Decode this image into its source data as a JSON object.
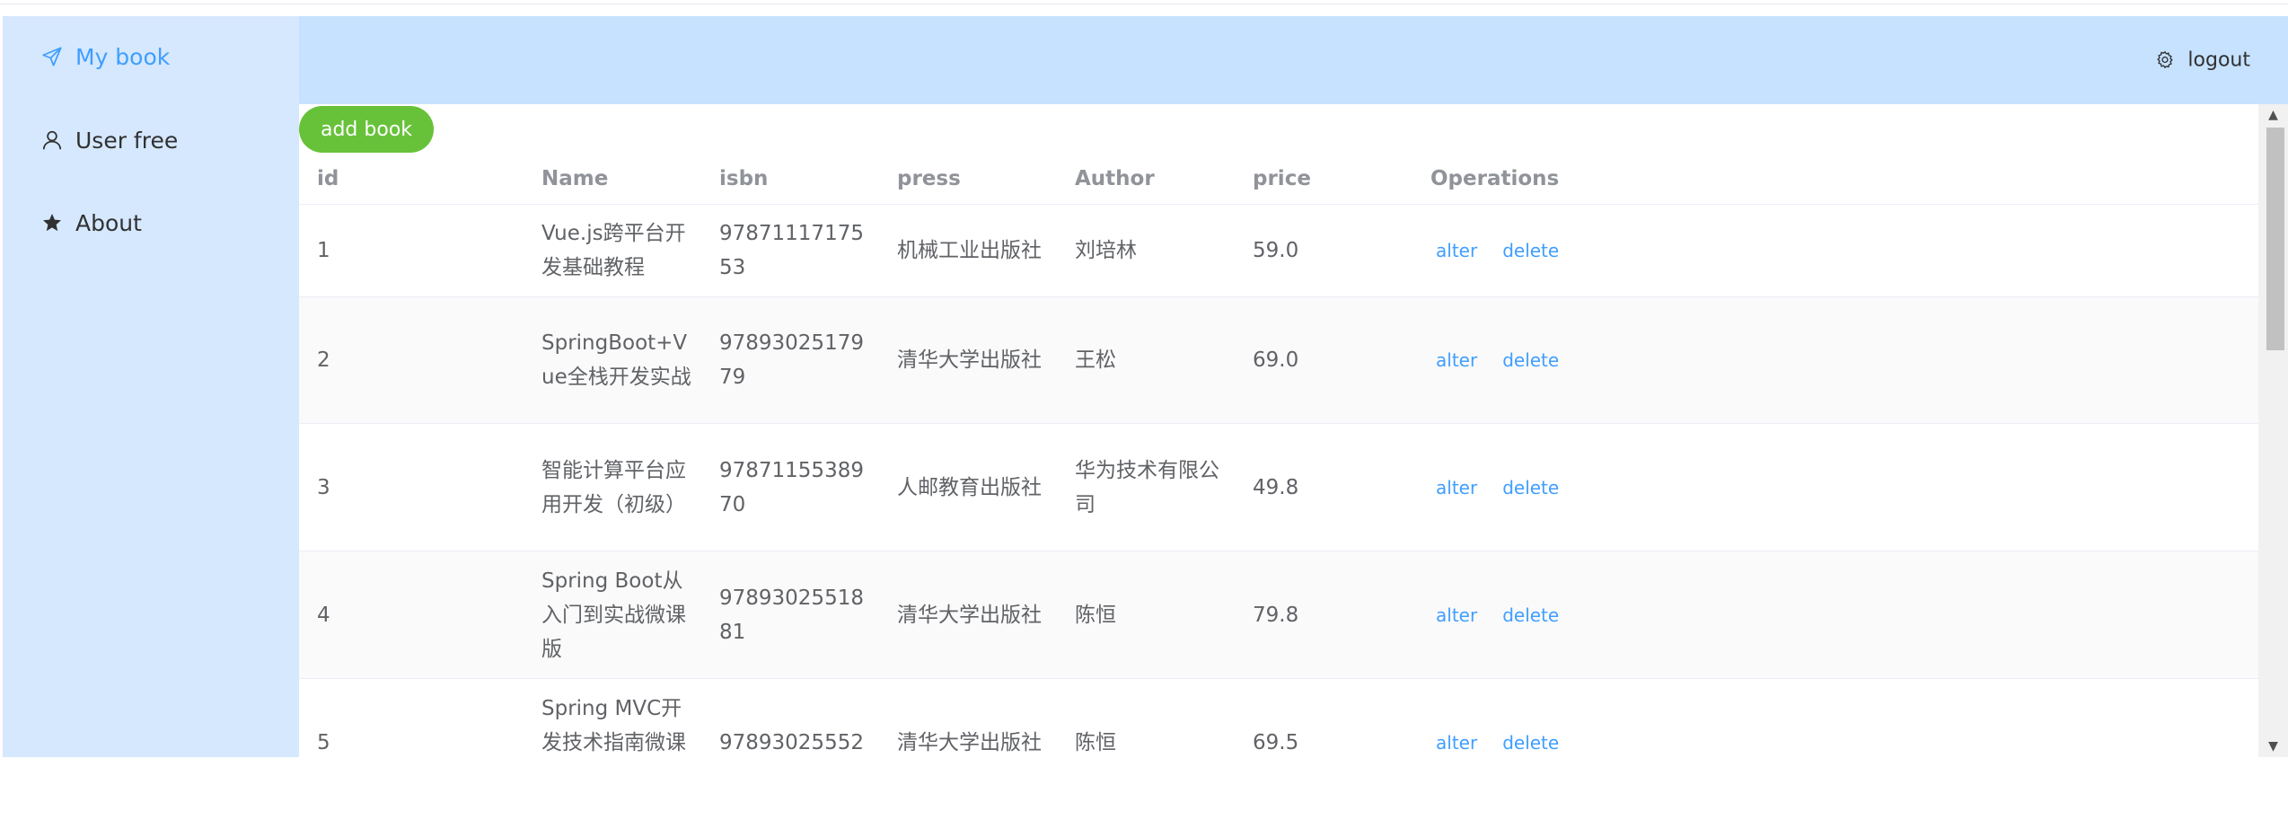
{
  "sidebar": {
    "items": [
      {
        "label": "My book",
        "icon": "send-icon",
        "active": true
      },
      {
        "label": "User free",
        "icon": "user-icon",
        "active": false
      },
      {
        "label": "About",
        "icon": "star-icon",
        "active": false
      }
    ]
  },
  "header": {
    "logout_label": "logout",
    "logout_icon": "gear-icon"
  },
  "toolbar": {
    "add_label": "add book"
  },
  "table": {
    "columns": [
      "id",
      "Name",
      "isbn",
      "press",
      "Author",
      "price",
      "Operations"
    ],
    "alter_label": "alter",
    "delete_label": "delete",
    "rows": [
      {
        "id": "1",
        "name": "Vue.js跨平台开发基础教程",
        "isbn": "9787111717553",
        "press": "机械工业出版社",
        "author": "刘培林",
        "price": "59.0"
      },
      {
        "id": "2",
        "name": "SpringBoot+Vue全栈开发实战",
        "isbn": "9789302517979",
        "press": "清华大学出版社",
        "author": "王松",
        "price": "69.0"
      },
      {
        "id": "3",
        "name": "智能计算平台应用开发（初级）",
        "isbn": "9787115538970",
        "press": "人邮教育出版社",
        "author": "华为技术有限公司",
        "price": "49.8"
      },
      {
        "id": "4",
        "name": "Spring Boot从入门到实战微课版",
        "isbn": "9789302551881",
        "press": "清华大学出版社",
        "author": "陈恒",
        "price": "79.8"
      },
      {
        "id": "5",
        "name": "Spring MVC开发技术指南微课版",
        "isbn": "97893025552",
        "press": "清华大学出版社",
        "author": "陈恒",
        "price": "69.5"
      }
    ]
  },
  "colors": {
    "sidebar_bg": "#d5e8fd",
    "header_bg": "#c6e2ff",
    "accent": "#409eff",
    "add_button": "#67c23a"
  }
}
